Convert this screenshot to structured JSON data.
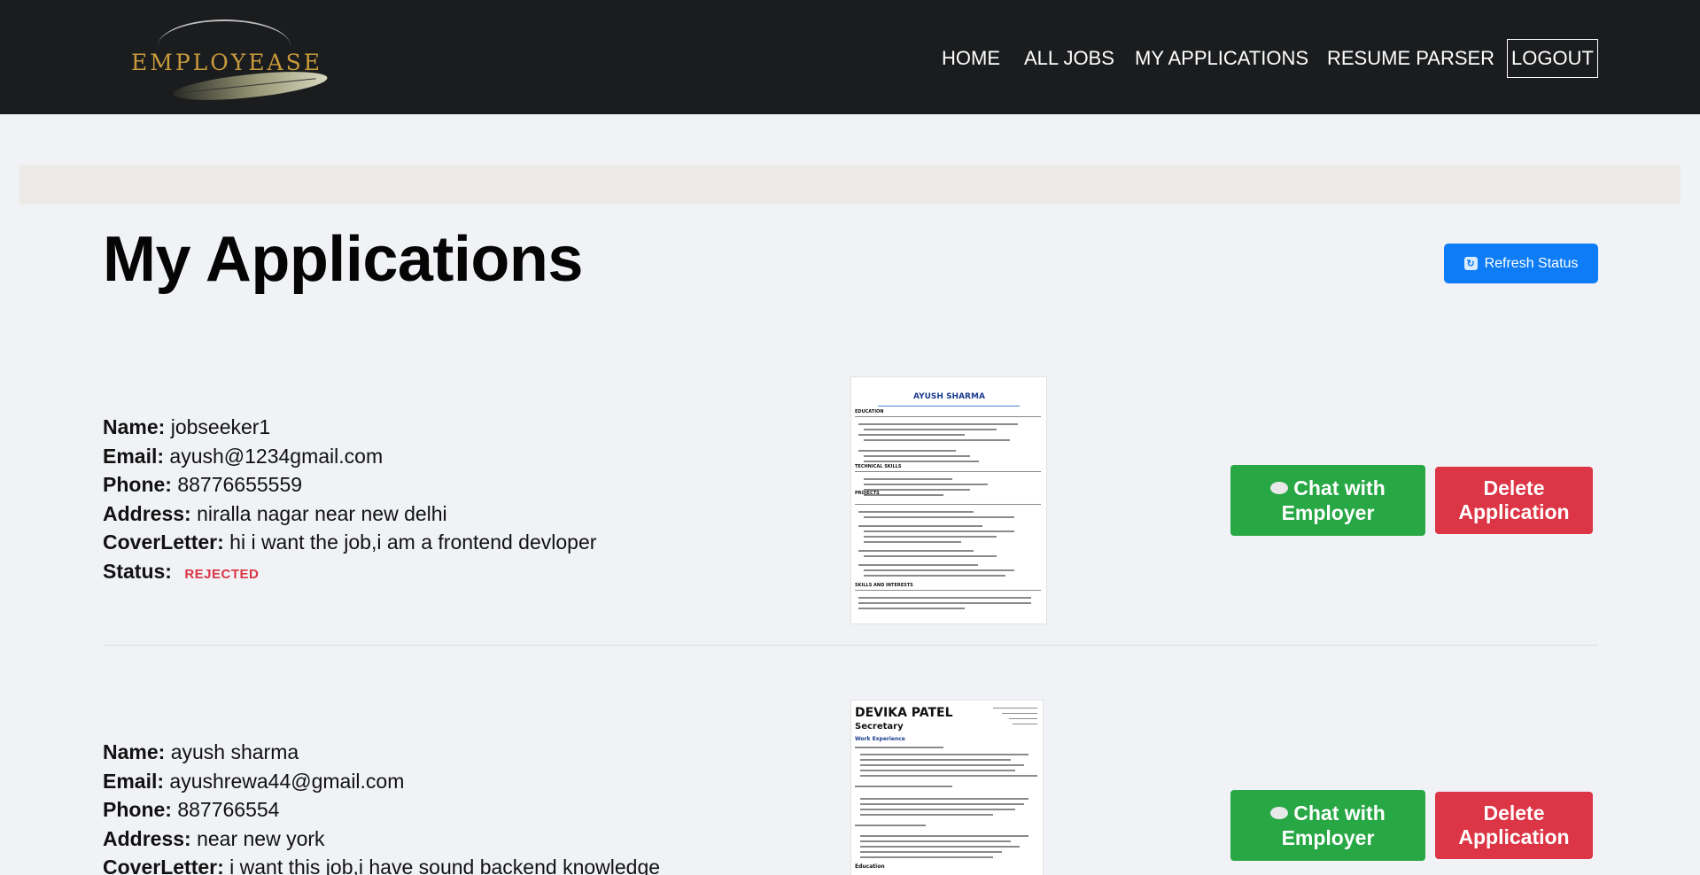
{
  "navbar": {
    "logo_text": "EMPLOYEASE",
    "links": [
      "HOME",
      "ALL JOBS",
      "MY APPLICATIONS",
      "RESUME PARSER"
    ],
    "logout_label": "LOGOUT"
  },
  "page": {
    "title": "My Applications",
    "refresh_label": "Refresh Status"
  },
  "labels": {
    "name": "Name:",
    "email": "Email:",
    "phone": "Phone:",
    "address": "Address:",
    "cover_letter": "CoverLetter:",
    "status": "Status:"
  },
  "applications": [
    {
      "name": "jobseeker1",
      "email": "ayush@1234gmail.com",
      "phone": "88776655559",
      "address": "niralla nagar near new delhi",
      "cover_letter": "hi i want the job,i am a frontend devloper",
      "status": "REJECTED",
      "resume": {
        "name": "AYUSH SHARMA",
        "sections": [
          "EDUCATION",
          "TECHNICAL SKILLS",
          "PROJECTS",
          "SKILLS AND INTERESTS"
        ]
      },
      "chat_label": "Chat with Employer",
      "delete_label": "Delete Application"
    },
    {
      "name": "ayush sharma",
      "email": "ayushrewa44@gmail.com",
      "phone": "887766554",
      "address": "near new york",
      "cover_letter": "i want this job,i have sound backend knowledge",
      "resume": {
        "name": "DEVIKA PATEL",
        "title": "Secretary",
        "sections": [
          "Work Experience",
          "Education"
        ]
      },
      "chat_label": "Chat with Employer",
      "delete_label": "Delete Application"
    }
  ],
  "colors": {
    "navbar_bg": "#1b1c1e",
    "page_bg": "#f0f2f6",
    "refresh_blue": "#0d7cf6",
    "chat_green": "#28a745",
    "delete_red": "#dc3545",
    "status_rejected": "#dc3545"
  },
  "icons": {
    "refresh": "refresh-icon",
    "chat": "chat-bubble-icon"
  }
}
